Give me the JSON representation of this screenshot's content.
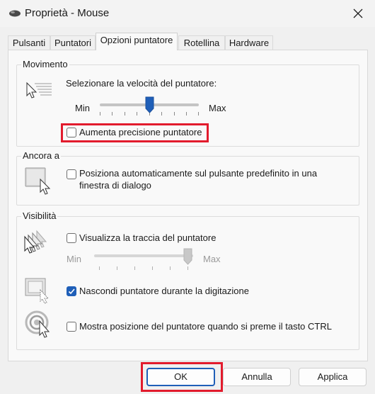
{
  "window": {
    "title": "Proprietà - Mouse",
    "icon": "mouse-icon"
  },
  "tabs": [
    {
      "label": "Pulsanti",
      "active": false
    },
    {
      "label": "Puntatori",
      "active": false
    },
    {
      "label": "Opzioni puntatore",
      "active": true
    },
    {
      "label": "Rotellina",
      "active": false
    },
    {
      "label": "Hardware",
      "active": false
    }
  ],
  "movement": {
    "group_label": "Movimento",
    "speed_label": "Selezionare la velocità del puntatore:",
    "min_label": "Min",
    "max_label": "Max",
    "speed_value": 0.5,
    "enhance_precision": {
      "label": "Aumenta precisione puntatore",
      "checked": false
    }
  },
  "snap_to": {
    "group_label": "Ancora a",
    "checkbox": {
      "label_line1": "Posiziona automaticamente sul pulsante predefinito in una",
      "label_line2": "finestra di dialogo",
      "checked": false
    }
  },
  "visibility": {
    "group_label": "Visibilità",
    "trail": {
      "label": "Visualizza la traccia del puntatore",
      "checked": false
    },
    "trail_min": "Min",
    "trail_max": "Max",
    "trail_value": 1.0,
    "hide_typing": {
      "label": "Nascondi puntatore durante la digitazione",
      "checked": true
    },
    "show_ctrl": {
      "label": "Mostra posizione del puntatore quando si preme il tasto CTRL",
      "checked": false
    }
  },
  "buttons": {
    "ok": "OK",
    "cancel": "Annulla",
    "apply": "Applica"
  },
  "highlight_color": "#e21b2d",
  "accent_color": "#1f5fb8"
}
